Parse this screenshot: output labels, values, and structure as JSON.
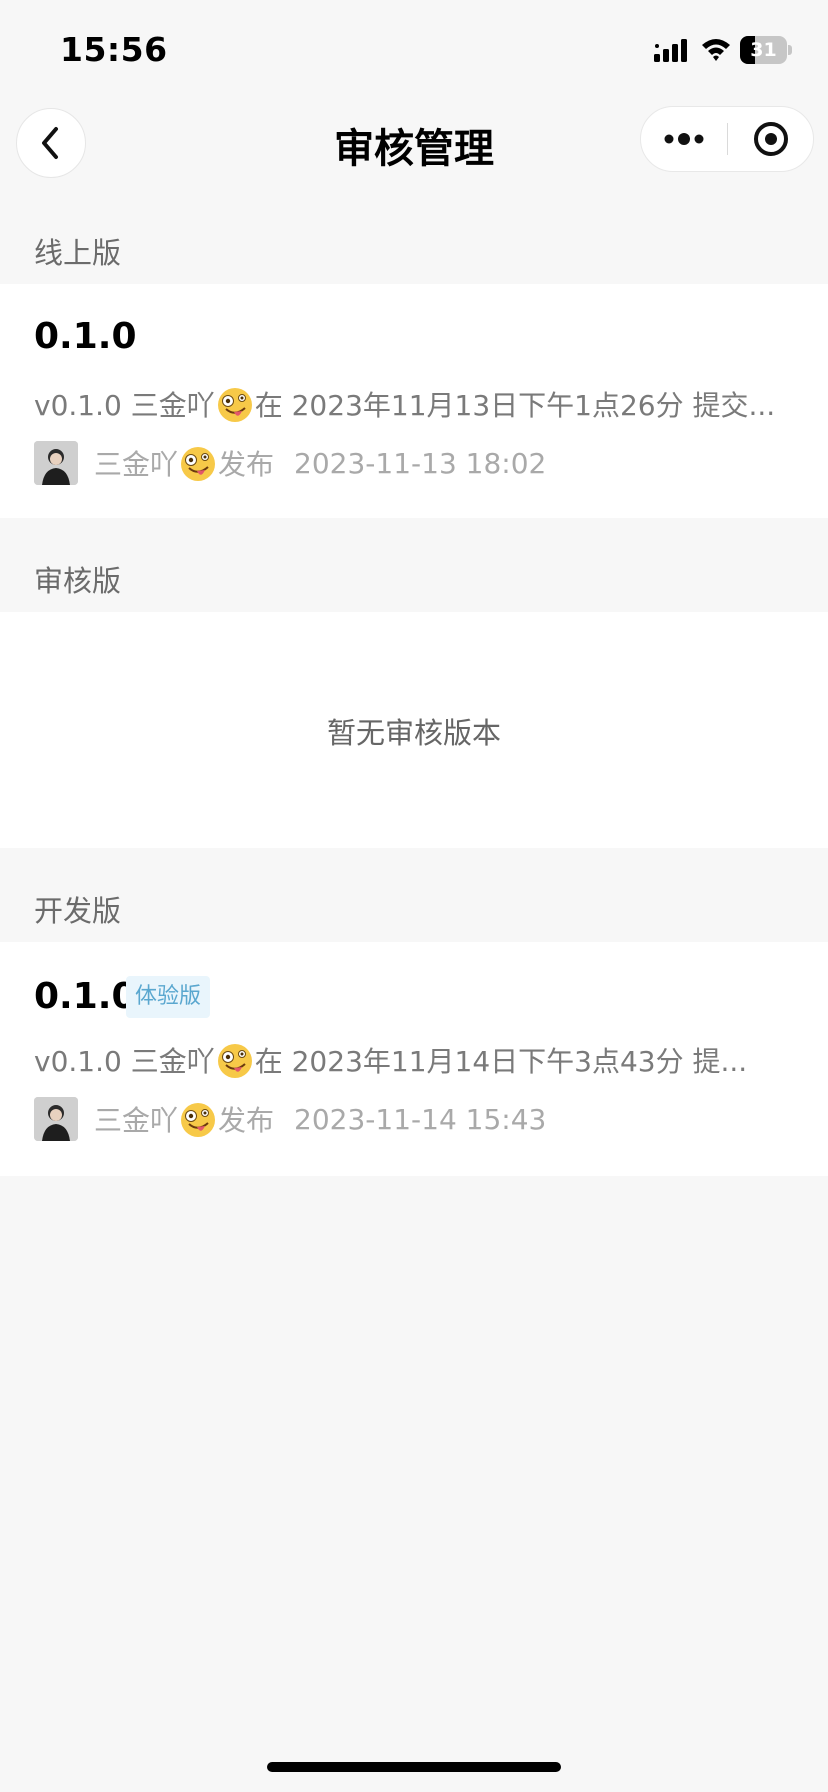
{
  "status_bar": {
    "time": "15:56",
    "battery": "31",
    "battery_level": 0.31
  },
  "nav": {
    "title": "审核管理"
  },
  "icons": {
    "back": "chevron-left-icon",
    "more": "more-dots-icon",
    "close": "target-circle-icon",
    "signal": "signal-icon",
    "wifi": "wifi-icon",
    "battery": "battery-icon",
    "emoji_desc": "zany-face-emoji",
    "emoji_pub": "zany-face-emoji"
  },
  "sections": {
    "online": {
      "header": "线上版",
      "version": "0.1.0",
      "desc_pre": "v0.1.0 三金吖",
      "desc_post": "在 2023年11月13日下午1点26分 提交...",
      "publisher": "三金吖",
      "publish_word": "发布",
      "time": "2023-11-13 18:02"
    },
    "review": {
      "header": "审核版",
      "empty": "暂无审核版本"
    },
    "dev": {
      "header": "开发版",
      "version": "0.1.0",
      "badge": "体验版",
      "desc_pre": "v0.1.0 三金吖",
      "desc_post": "在 2023年11月14日下午3点43分 提...",
      "publisher": "三金吖",
      "publish_word": "发布",
      "time": "2023-11-14 15:43"
    }
  },
  "colors": {
    "badge_text": "#5aa7cf",
    "badge_bg": "#e9f5fc",
    "page_bg": "#f7f7f7"
  }
}
